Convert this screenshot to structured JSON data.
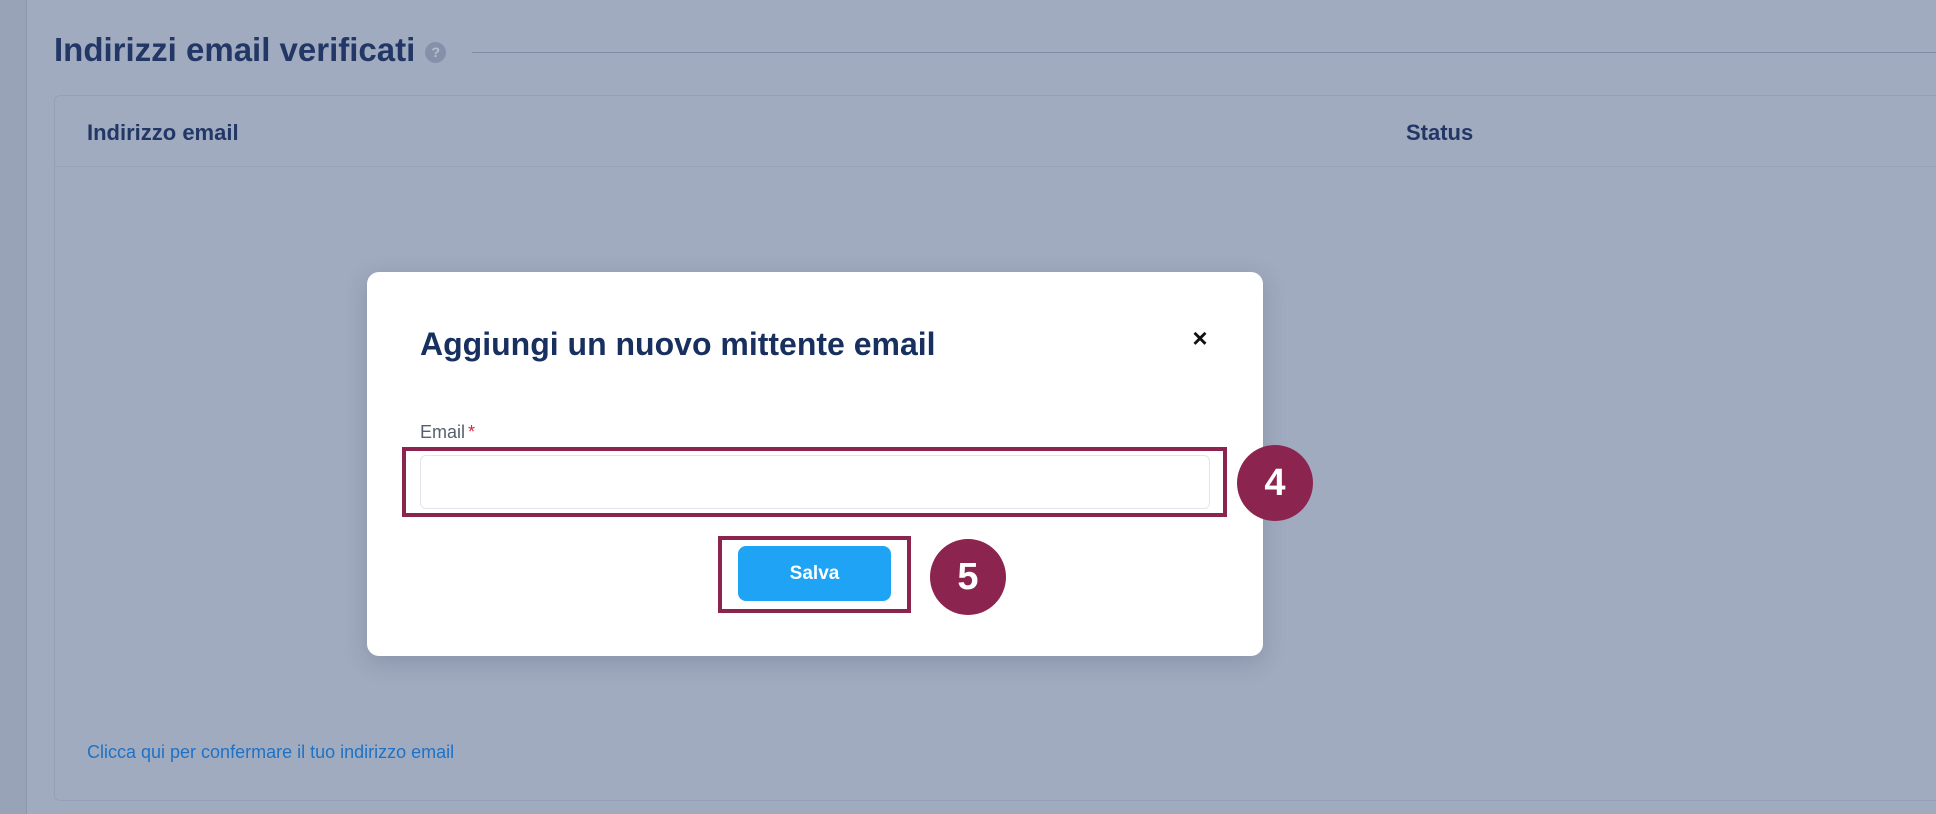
{
  "section": {
    "title": "Indirizzi email verificati",
    "help_icon_glyph": "?"
  },
  "table": {
    "columns": [
      "Indirizzo email",
      "Status"
    ],
    "confirm_link": "Clicca qui per confermare il tuo indirizzo email"
  },
  "modal": {
    "title": "Aggiungi un nuovo mittente email",
    "close_glyph": "×",
    "email_label": "Email",
    "required_mark": "*",
    "email_value": "",
    "save_label": "Salva"
  },
  "annotations": {
    "step_input": "4",
    "step_button": "5"
  },
  "colors": {
    "overlay_background": "#a0abbf",
    "heading_navy": "#223766",
    "link_blue": "#1d72c6",
    "primary_button": "#1fa3f5",
    "annotation_maroon": "#8c2450",
    "required_red": "#d6283b"
  }
}
